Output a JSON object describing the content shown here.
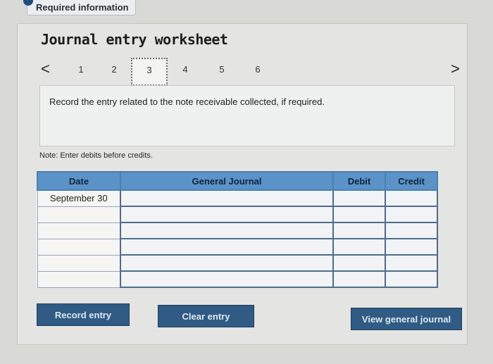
{
  "header": {
    "tab_label": "Required information"
  },
  "worksheet": {
    "title": "Journal entry worksheet",
    "steps": [
      "1",
      "2",
      "3",
      "4",
      "5",
      "6"
    ],
    "active_step": "3",
    "prev_symbol": "<",
    "next_symbol": ">",
    "instruction": "Record the entry related to the note receivable collected, if required.",
    "note": "Note: Enter debits before credits."
  },
  "table": {
    "columns": [
      "Date",
      "General Journal",
      "Debit",
      "Credit"
    ],
    "rows": [
      {
        "date": "September 30",
        "account": "",
        "debit": "",
        "credit": ""
      },
      {
        "date": "",
        "account": "",
        "debit": "",
        "credit": ""
      },
      {
        "date": "",
        "account": "",
        "debit": "",
        "credit": ""
      },
      {
        "date": "",
        "account": "",
        "debit": "",
        "credit": ""
      },
      {
        "date": "",
        "account": "",
        "debit": "",
        "credit": ""
      },
      {
        "date": "",
        "account": "",
        "debit": "",
        "credit": ""
      }
    ]
  },
  "buttons": {
    "record": "Record entry",
    "clear": "Clear entry",
    "view": "View general journal"
  }
}
